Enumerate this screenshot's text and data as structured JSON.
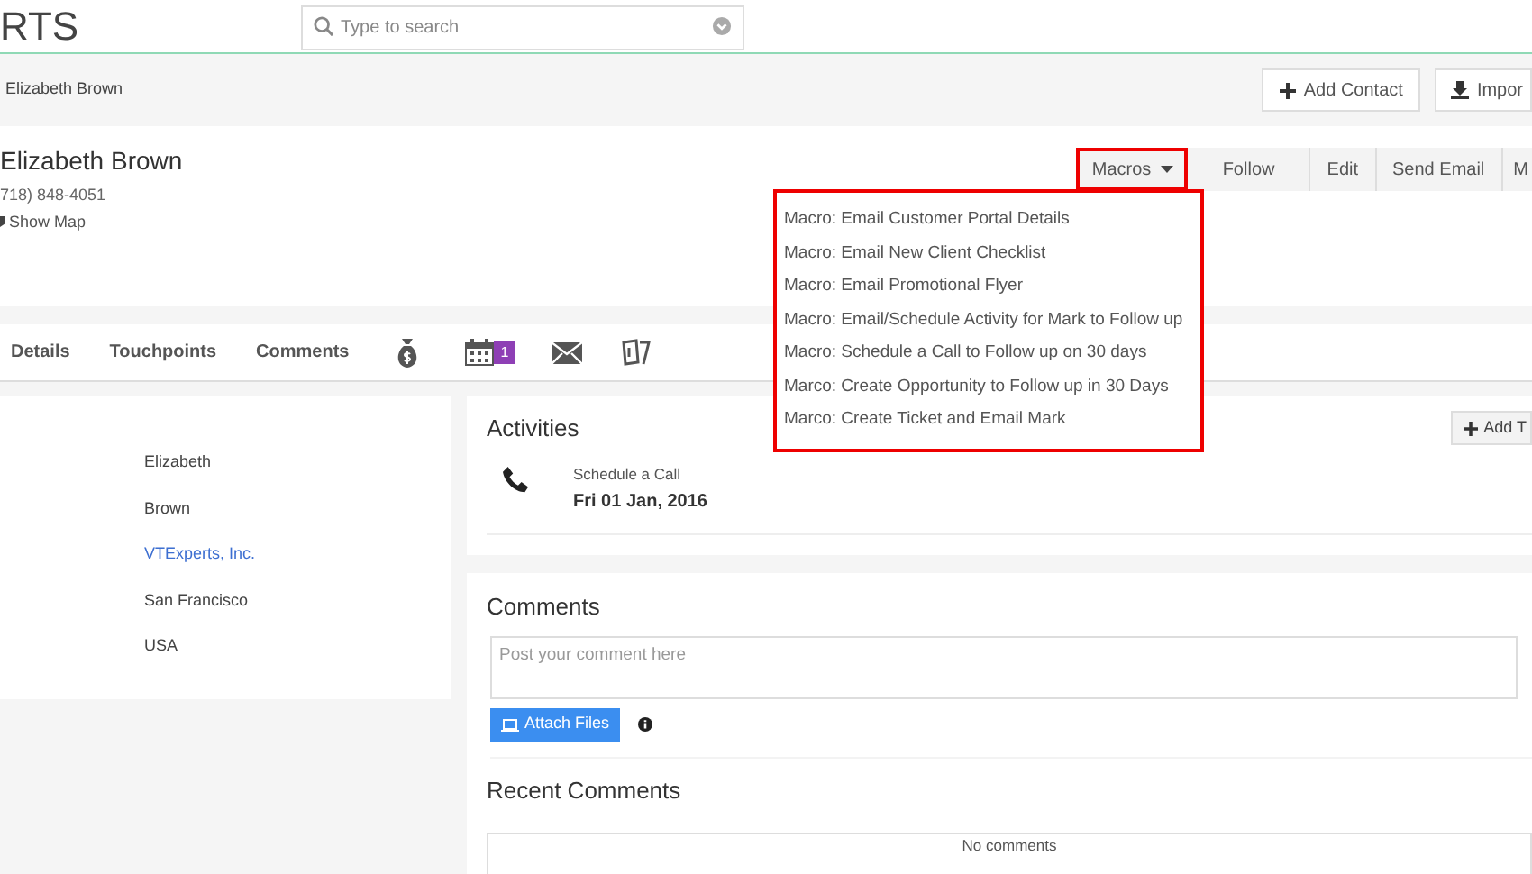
{
  "header": {
    "logo": "RTS",
    "search": {
      "placeholder": "Type to search"
    }
  },
  "breadcrumb": {
    "label": "Elizabeth Brown",
    "buttons": [
      {
        "label": "Add Contact",
        "kind": "add"
      },
      {
        "label": "Impor",
        "kind": "import"
      }
    ]
  },
  "record": {
    "name": "Elizabeth Brown",
    "phone": "718) 848-4051",
    "map_link": "Show Map"
  },
  "actions": [
    {
      "label": "Macros",
      "kind": "dropdown",
      "expanded": true
    },
    {
      "label": "Follow",
      "kind": "button"
    },
    {
      "label": "Edit",
      "kind": "button"
    },
    {
      "label": "Send Email",
      "kind": "button"
    },
    {
      "label": "M",
      "kind": "button"
    }
  ],
  "macros_menu": [
    "Macro: Email Customer Portal Details",
    "Macro: Email New Client Checklist",
    "Macro: Email Promotional Flyer",
    "Macro: Email/Schedule Activity for Mark to Follow up",
    "Macro: Schedule a Call to Follow up on 30 days",
    "Marco: Create Opportunity to Follow up in 30 Days",
    "Marco: Create Ticket and Email Mark"
  ],
  "tabs": [
    {
      "kind": "text",
      "label": "Details"
    },
    {
      "kind": "text",
      "label": "Touchpoints"
    },
    {
      "kind": "text",
      "label": "Comments"
    },
    {
      "kind": "money"
    },
    {
      "kind": "calendar",
      "badge": "1"
    },
    {
      "kind": "mail"
    },
    {
      "kind": "tickets"
    }
  ],
  "fields": [
    "Elizabeth",
    "Brown",
    {
      "text": "VTExperts, Inc.",
      "link": true
    },
    "San Francisco",
    "USA"
  ],
  "activities": {
    "title": "Activities",
    "add_button": "Add T",
    "items": [
      {
        "title": "Schedule a Call",
        "date": "Fri 01 Jan, 2016"
      }
    ]
  },
  "comments": {
    "title": "Comments",
    "placeholder": "Post your comment here",
    "attach": "Attach Files",
    "recent_title": "Recent Comments",
    "empty": "No comments"
  }
}
